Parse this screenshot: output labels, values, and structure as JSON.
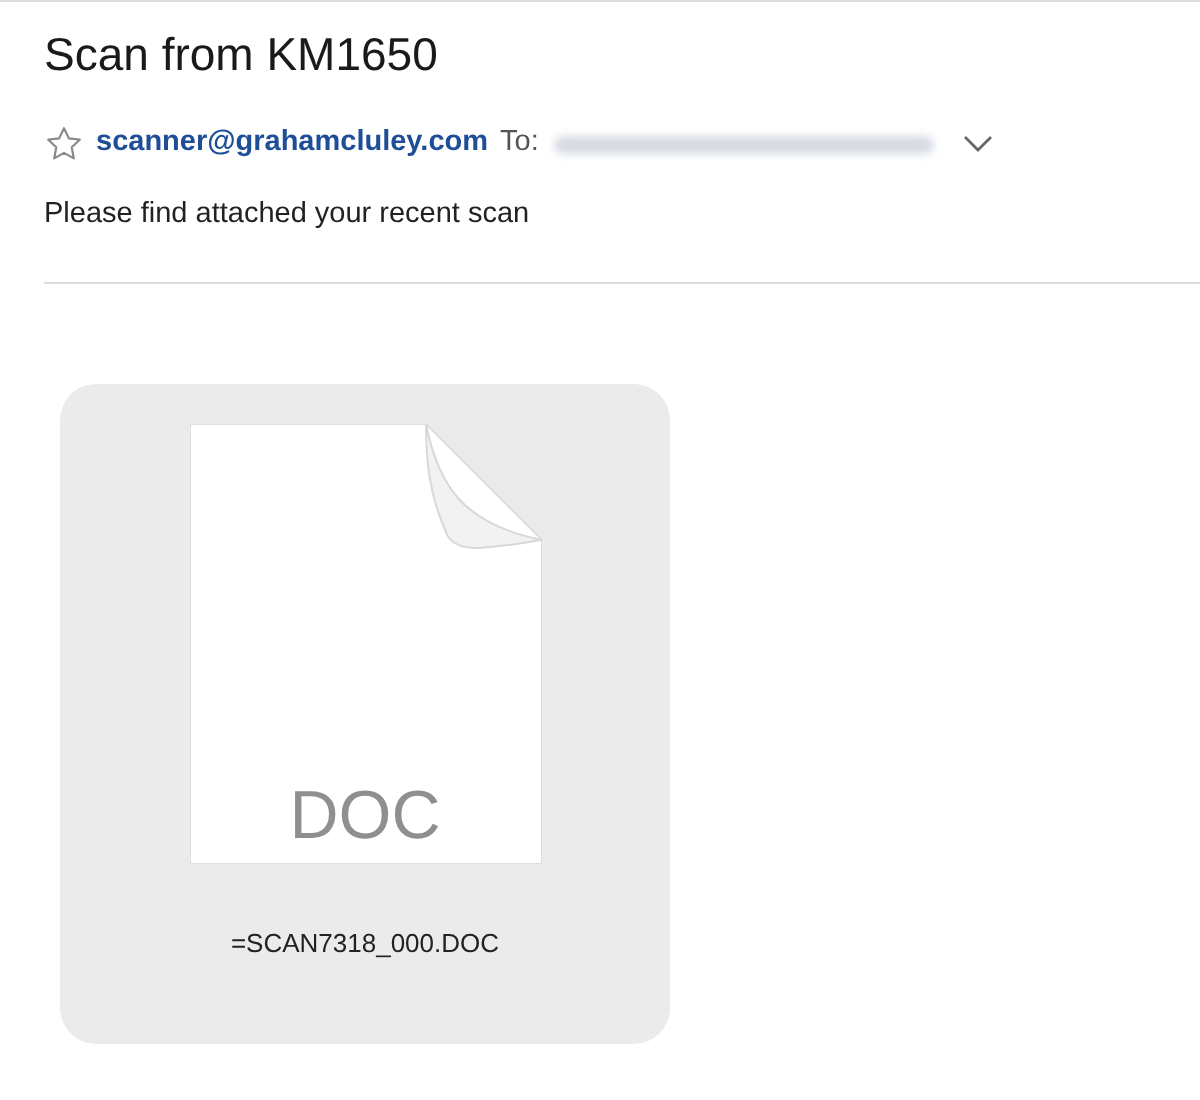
{
  "message": {
    "subject": "Scan from KM1650",
    "sender": "scanner@grahamcluley.com",
    "to_label": "To:",
    "body": "Please find attached your recent scan",
    "attachment": {
      "type_label": "DOC",
      "filename": "=SCAN7318_000.DOC"
    }
  }
}
